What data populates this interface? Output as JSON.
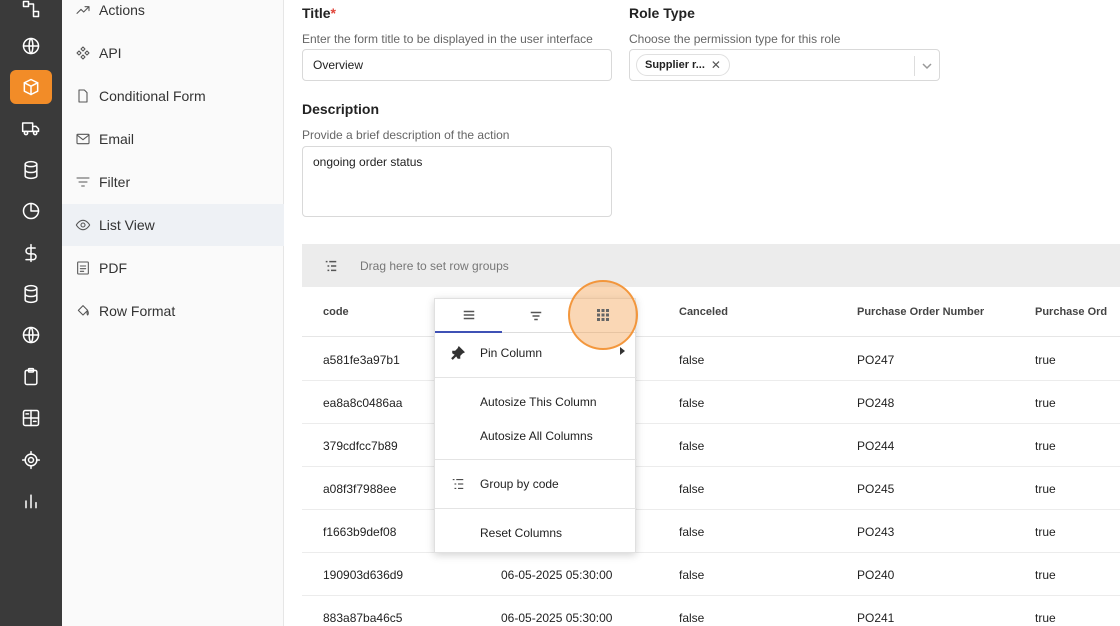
{
  "rail": {
    "icons": [
      "workflow-icon",
      "globe-icon",
      "box-icon",
      "truck-icon",
      "database-icon",
      "pie-chart-icon",
      "dollar-icon",
      "database-icon",
      "globe-icon",
      "clipboard-icon",
      "dashboard-icon",
      "target-icon",
      "bar-chart-icon"
    ],
    "active_index": 2,
    "accent": "#f28c28"
  },
  "sidebar": {
    "items": [
      {
        "label": "Actions",
        "icon": "trend-icon"
      },
      {
        "label": "API",
        "icon": "api-icon"
      },
      {
        "label": "Conditional Form",
        "icon": "file-icon"
      },
      {
        "label": "Email",
        "icon": "mail-icon"
      },
      {
        "label": "Filter",
        "icon": "filter-icon"
      },
      {
        "label": "List View",
        "icon": "eye-icon"
      },
      {
        "label": "PDF",
        "icon": "pdf-icon"
      },
      {
        "label": "Row Format",
        "icon": "paint-bucket-icon"
      }
    ],
    "active_index": 5
  },
  "form": {
    "title_label": "Title",
    "title_required": "*",
    "title_hint": "Enter the form title to be displayed in the user interface",
    "title_value": "Overview",
    "role_label": "Role Type",
    "role_hint": "Choose the permission type for this role",
    "role_chip": "Supplier r...",
    "role_chip_remove": "✕",
    "description_label": "Description",
    "description_hint": "Provide a brief description of the action",
    "description_value": "ongoing order status"
  },
  "grid": {
    "group_bar_text": "Drag here to set row groups",
    "columns": [
      "code",
      "",
      "Canceled",
      "Purchase Order Number",
      "Purchase Ord"
    ],
    "rows": [
      {
        "code": "a581fe3a97b1",
        "date": "",
        "canceled": "false",
        "po": "PO247",
        "flag": "true"
      },
      {
        "code": "ea8a8c0486aa",
        "date": "",
        "canceled": "false",
        "po": "PO248",
        "flag": "true"
      },
      {
        "code": "379cdfcc7b89",
        "date": "",
        "canceled": "false",
        "po": "PO244",
        "flag": "true"
      },
      {
        "code": "a08f3f7988ee",
        "date": "",
        "canceled": "false",
        "po": "PO245",
        "flag": "true"
      },
      {
        "code": "f1663b9def08",
        "date": "",
        "canceled": "false",
        "po": "PO243",
        "flag": "true"
      },
      {
        "code": "190903d636d9",
        "date": "06-05-2025 05:30:00",
        "canceled": "false",
        "po": "PO240",
        "flag": "true"
      },
      {
        "code": "883a87ba46c5",
        "date": "06-05-2025 05:30:00",
        "canceled": "false",
        "po": "PO241",
        "flag": "true"
      }
    ]
  },
  "column_menu": {
    "tabs": [
      "menu-lines-icon",
      "filter-icon",
      "columns-grid-icon"
    ],
    "active_tab": 0,
    "items": {
      "pin": "Pin Column",
      "autosize_this": "Autosize This Column",
      "autosize_all": "Autosize All Columns",
      "group_by": "Group by code",
      "reset": "Reset Columns"
    },
    "tab_accent": "#3f51b5"
  }
}
